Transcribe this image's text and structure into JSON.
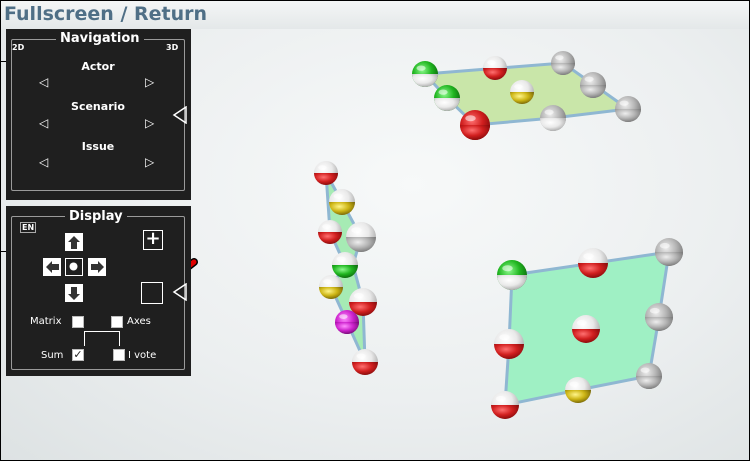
{
  "title": "Fullscreen / Return",
  "navigation": {
    "legend": "Navigation",
    "mode_2d": "2D",
    "mode_3d": "3D",
    "rows": [
      {
        "label": "Actor"
      },
      {
        "label": "Scenario"
      },
      {
        "label": "Issue"
      }
    ],
    "left_arrow": "◁",
    "right_arrow": "▷"
  },
  "display": {
    "legend": "Display",
    "language": "EN",
    "plus": "+",
    "matrix_label": "Matrix",
    "axes_label": "Axes",
    "sum_label": "Sum",
    "ivote_label": "I vote",
    "sum_checked": true,
    "matrix_checked": false,
    "axes_checked": false,
    "ivote_checked": false,
    "check_mark": "✓"
  },
  "colors": {
    "title": "#4f6f86",
    "panel": "#1f1f1f",
    "plane_green": "#9ff0c4",
    "plane_lightgreen": "#c9e6a9",
    "edge_blue": "#8fb7d2",
    "ball_red": "#cc1f1f",
    "ball_green": "#26b526",
    "ball_yellow": "#c8b214",
    "ball_gray": "#9a9a9a",
    "ball_magenta": "#cc22cc",
    "annotation_arrow": "#e00000"
  },
  "icons": [
    "arrow-up-icon",
    "arrow-left-icon",
    "center-dot-icon",
    "arrow-right-icon",
    "arrow-down-icon",
    "plus-icon",
    "triangle-left-icon",
    "annotation-arrow-icon"
  ]
}
